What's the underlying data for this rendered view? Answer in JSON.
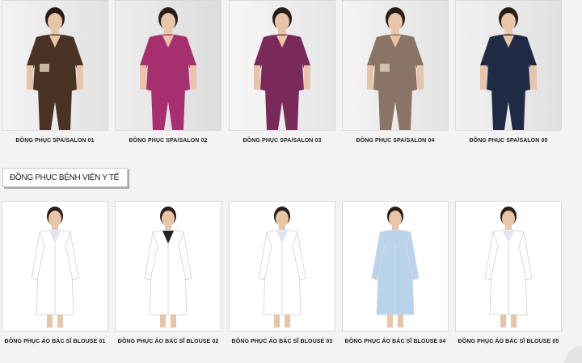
{
  "section_spa": {
    "products": [
      {
        "caption": "ĐỒNG PHỤC SPA/SALON 01",
        "image": "brown-spa-uniform",
        "color": "#4a3224",
        "accent": "#d9c7b0",
        "bg": "#efefef"
      },
      {
        "caption": "ĐỒNG PHỤC SPA/SALON 02",
        "image": "magenta-spa-uniform",
        "color": "#a6306f",
        "accent": "#a6306f",
        "bg": "#e8e8e8"
      },
      {
        "caption": "ĐỒNG PHỤC SPA/SALON 03",
        "image": "purple-scrubs-man",
        "color": "#7a2a5a",
        "accent": "#7a2a5a",
        "bg": "#f4f4f4"
      },
      {
        "caption": "ĐỒNG PHỤC SPA/SALON 04",
        "image": "taupe-spa-uniform",
        "color": "#8a7466",
        "accent": "#d8c8b6",
        "bg": "#f0f0f0"
      },
      {
        "caption": "ĐỒNG PHỤC SPA/SALON 05",
        "image": "navy-spa-uniform",
        "color": "#1f2a44",
        "accent": "#1f2a44",
        "bg": "#ededed"
      }
    ]
  },
  "section_hospital": {
    "title": "ĐỒNG PHỤC BỆNH VIỆN Y TẾ",
    "products": [
      {
        "caption": "ĐỒNG PHỤC ÁO BÁC SĨ BLOUSE 01",
        "image": "white-long-lab-coat",
        "color": "#ffffff",
        "accent": "#dfe6ee",
        "bg": "#ffffff"
      },
      {
        "caption": "ĐỒNG PHỤC ÁO BÁC SĨ BLOUSE 02",
        "image": "white-short-coats-pair",
        "color": "#ffffff",
        "accent": "#222222",
        "bg": "#ffffff"
      },
      {
        "caption": "ĐỒNG PHỤC ÁO BÁC SĨ BLOUSE 03",
        "image": "white-dress-lab-coat",
        "color": "#ffffff",
        "accent": "#dfe6ee",
        "bg": "#ffffff"
      },
      {
        "caption": "ĐỒNG PHỤC ÁO BÁC SĨ BLOUSE 04",
        "image": "light-blue-nurse-uniform",
        "color": "#b9d3ea",
        "accent": "#b9d3ea",
        "bg": "#ffffff"
      },
      {
        "caption": "ĐỒNG PHỤC ÁO BÁC SĨ BLOUSE 05",
        "image": "white-short-dress-coat",
        "color": "#ffffff",
        "accent": "#dfe6ee",
        "bg": "#ffffff"
      }
    ]
  }
}
